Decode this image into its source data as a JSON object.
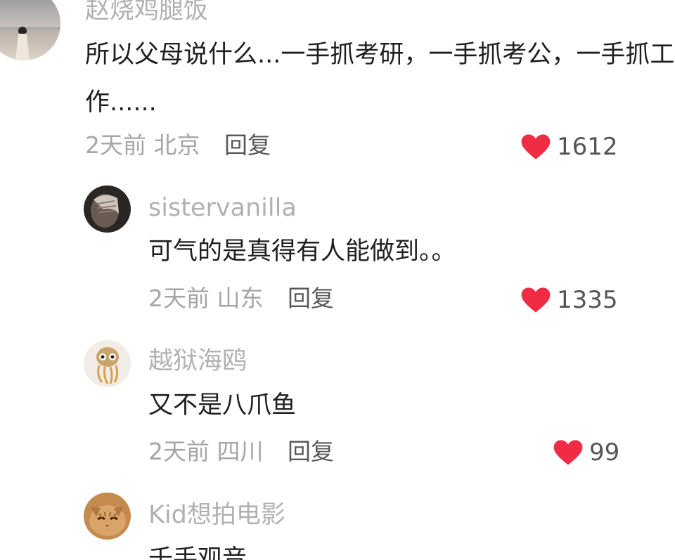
{
  "comments": [
    {
      "username": "赵烧鸡腿饭",
      "text": "所以父母说什么...一手抓考研，一手抓考公，一手抓工作......",
      "time": "2天前",
      "location": "北京",
      "reply_label": "回复",
      "likes": "1612",
      "avatar_icon": "avatar-photo-beach-girl"
    },
    {
      "username": "sistervanilla",
      "text": "可气的是真得有人能做到。。",
      "time": "2天前",
      "location": "山东",
      "reply_label": "回复",
      "likes": "1335",
      "avatar_icon": "avatar-photo-hand-face"
    },
    {
      "username": "越狱海鸥",
      "text": "又不是八爪鱼",
      "time": "2天前",
      "location": "四川",
      "reply_label": "回复",
      "likes": "99",
      "avatar_icon": "avatar-cartoon-octopus"
    },
    {
      "username": "Kid想拍电影",
      "text": "千手观音",
      "avatar_icon": "avatar-photo-cat"
    }
  ],
  "colors": {
    "heart": "#f02c44",
    "username": "#b1b1b1",
    "content": "#1f1f1f",
    "meta": "#a6a6a6",
    "reply": "#585858"
  }
}
